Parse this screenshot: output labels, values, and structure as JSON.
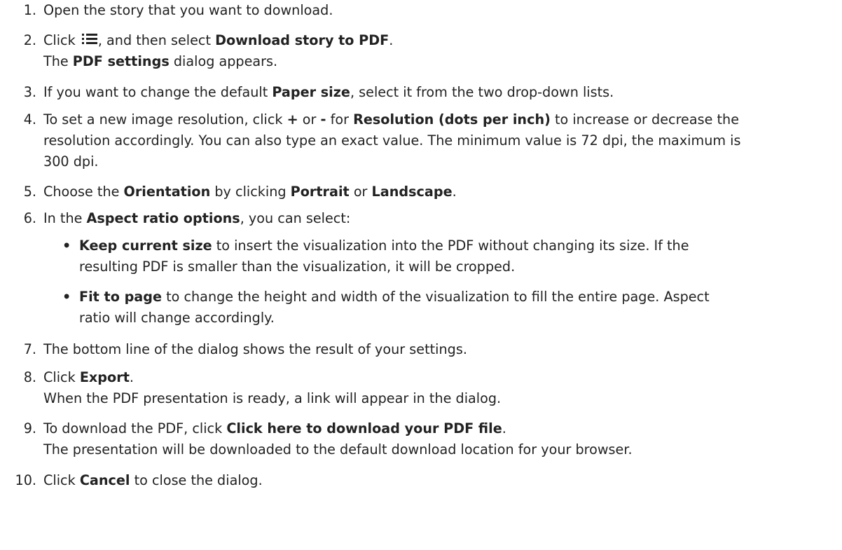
{
  "steps": [
    {
      "num": "1.",
      "lines": [
        [
          {
            "t": "Open the story that you want to download."
          }
        ]
      ]
    },
    {
      "num": "2.",
      "lines": [
        [
          {
            "t": "Click "
          },
          {
            "icon": "list-menu-icon"
          },
          {
            "t": ", and then select "
          },
          {
            "t": "Download story to PDF",
            "b": true
          },
          {
            "t": "."
          }
        ],
        [
          {
            "t": "The "
          },
          {
            "t": "PDF settings",
            "b": true
          },
          {
            "t": " dialog appears."
          }
        ]
      ]
    },
    {
      "num": "3.",
      "lines": [
        [
          {
            "t": "If you want to change the default "
          },
          {
            "t": "Paper size",
            "b": true
          },
          {
            "t": ", select it from the two drop-down lists."
          }
        ]
      ]
    },
    {
      "num": "4.",
      "lines": [
        [
          {
            "t": "To set a new image resolution, click "
          },
          {
            "t": "+",
            "b": true
          },
          {
            "t": " or "
          },
          {
            "t": "-",
            "b": true
          },
          {
            "t": " for "
          },
          {
            "t": "Resolution (dots per inch)",
            "b": true
          },
          {
            "t": " to increase or decrease the"
          }
        ],
        [
          {
            "t": "resolution accordingly. You can also type an exact value. The minimum value is 72 dpi, the maximum is"
          }
        ],
        [
          {
            "t": "300 dpi."
          }
        ]
      ]
    },
    {
      "num": "5.",
      "lines": [
        [
          {
            "t": "Choose the "
          },
          {
            "t": "Orientation",
            "b": true
          },
          {
            "t": " by clicking "
          },
          {
            "t": "Portrait",
            "b": true
          },
          {
            "t": " or "
          },
          {
            "t": "Landscape",
            "b": true
          },
          {
            "t": "."
          }
        ]
      ]
    },
    {
      "num": "6.",
      "lines": [
        [
          {
            "t": "In the "
          },
          {
            "t": "Aspect ratio options",
            "b": true
          },
          {
            "t": ", you can select:"
          }
        ]
      ]
    },
    {
      "num": "7.",
      "lines": [
        [
          {
            "t": "The bottom line of the dialog shows the result of your settings."
          }
        ]
      ]
    },
    {
      "num": "8.",
      "lines": [
        [
          {
            "t": "Click "
          },
          {
            "t": "Export",
            "b": true
          },
          {
            "t": "."
          }
        ],
        [
          {
            "t": "When the PDF presentation is ready, a link will appear in the dialog."
          }
        ]
      ]
    },
    {
      "num": "9.",
      "lines": [
        [
          {
            "t": "To download the PDF, click "
          },
          {
            "t": "Click here to download your PDF file",
            "b": true
          },
          {
            "t": "."
          }
        ],
        [
          {
            "t": "The presentation will be downloaded to the default download location for your browser."
          }
        ]
      ]
    },
    {
      "num": "10.",
      "lines": [
        [
          {
            "t": "Click "
          },
          {
            "t": "Cancel",
            "b": true
          },
          {
            "t": " to close the dialog."
          }
        ]
      ]
    }
  ],
  "bullets": [
    {
      "bullet": "•",
      "lines": [
        [
          {
            "t": "Keep current size",
            "b": true
          },
          {
            "t": " to insert the visualization into the PDF without changing its size. If the"
          }
        ],
        [
          {
            "t": "resulting PDF is smaller than the visualization, it will be cropped."
          }
        ]
      ]
    },
    {
      "bullet": "•",
      "lines": [
        [
          {
            "t": "Fit to page",
            "b": true
          },
          {
            "t": " to change the height and width of the visualization to fill the entire page. Aspect"
          }
        ],
        [
          {
            "t": "ratio will change accordingly."
          }
        ]
      ]
    }
  ]
}
